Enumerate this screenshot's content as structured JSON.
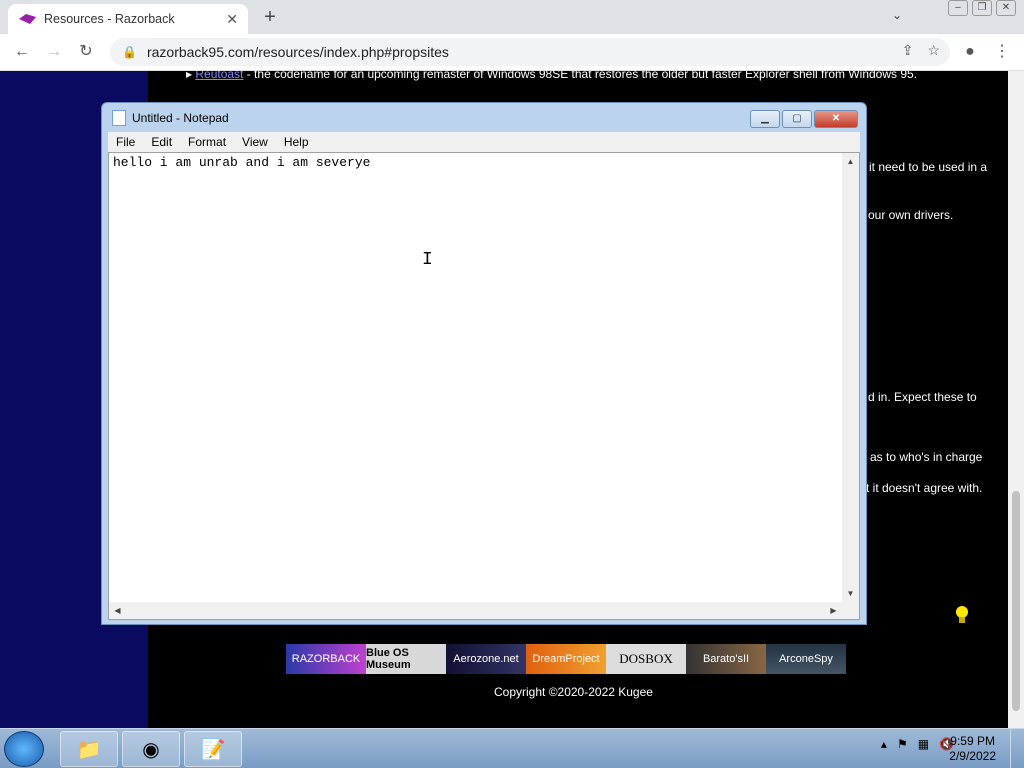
{
  "browser": {
    "tab_title": "Resources - Razorback",
    "address": "razorback95.com/resources/index.php#propsites"
  },
  "page": {
    "snippets": [
      {
        "text": "Reutoast",
        "rest": " - the codename for an upcoming remaster of Windows 98SE that restores the older but faster Explorer shell from Windows 95."
      },
      {
        "text": "it need to be used in a"
      },
      {
        "text": "our own drivers."
      },
      {
        "text": "d in. Expect these to"
      },
      {
        "text": "as to who's in charge"
      },
      {
        "text": "t it doesn't agree with."
      }
    ],
    "banners": [
      "RAZORBACK",
      "Blue OS Museum",
      "Aerozone.net",
      "DreamProject",
      "DOSBOX",
      "Barato'sII",
      "ArconeSpy"
    ],
    "copyright": "Copyright ©2020-2022 Kugee"
  },
  "notepad": {
    "title": "Untitled - Notepad",
    "menu": [
      "File",
      "Edit",
      "Format",
      "View",
      "Help"
    ],
    "content": "hello i am unrab and i am severye"
  },
  "taskbar": {
    "time": "9:59 PM",
    "date": "2/9/2022"
  }
}
